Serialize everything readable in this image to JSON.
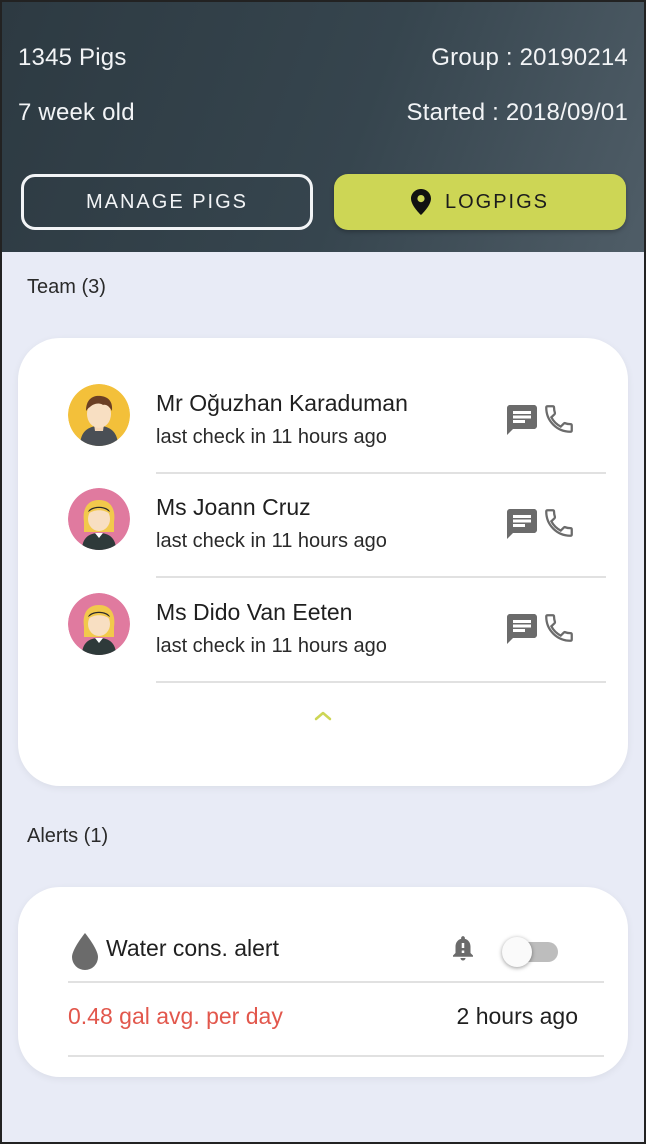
{
  "header": {
    "pigs_count": "1345 Pigs",
    "age": "7 week old",
    "group": "Group : 20190214",
    "started": "Started : 2018/09/01",
    "manage_button": "MANAGE PIGS",
    "log_button": "LOGPIGS",
    "log_icon": "location-pin-icon"
  },
  "team": {
    "title": "Team (3)",
    "members": [
      {
        "name": "Mr Oğuzhan Karaduman",
        "last_check": "last check in 11 hours ago",
        "avatar": "male-avatar"
      },
      {
        "name": "Ms Joann Cruz",
        "last_check": "last check in 11 hours ago",
        "avatar": "female-avatar"
      },
      {
        "name": "Ms Dido Van Eeten",
        "last_check": "last check in 11 hours ago",
        "avatar": "female-avatar"
      }
    ],
    "collapse_icon": "chevron-up-icon"
  },
  "alerts": {
    "title": "Alerts (1)",
    "items": [
      {
        "name": "Water cons. alert",
        "value": "0.48 gal avg. per day",
        "time": "2 hours ago",
        "enabled": false
      }
    ]
  },
  "colors": {
    "header_dark": "#2d3a42",
    "accent_lime": "#cdd655",
    "background": "#e8ebf6",
    "alert_red": "#e2574c",
    "icon_gray": "#6b6b6b"
  }
}
